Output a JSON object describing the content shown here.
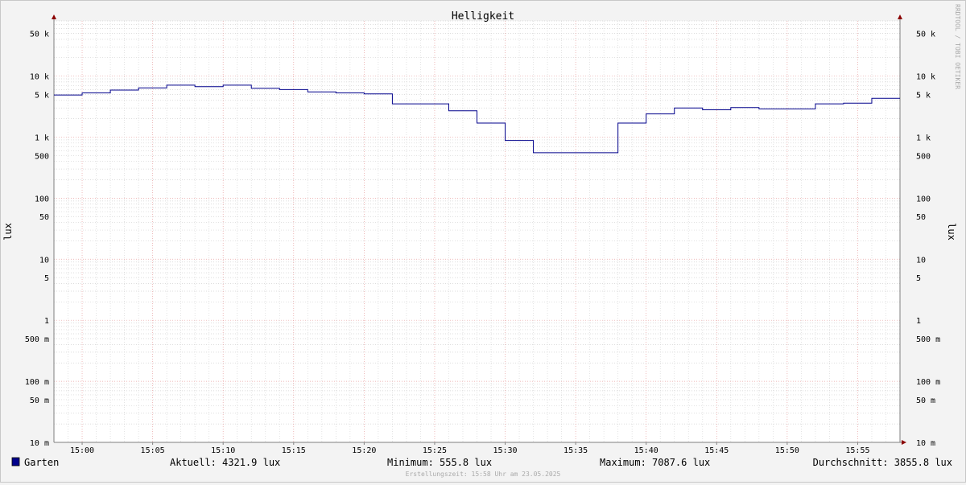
{
  "chart_data": {
    "type": "line",
    "title": "Helligkeit",
    "ylabel": "lux",
    "ylabel_right": "lux",
    "y_scale": "log",
    "ylim": [
      0.01,
      80000
    ],
    "y_ticks": [
      {
        "value": 50000,
        "label": "50 k"
      },
      {
        "value": 10000,
        "label": "10 k"
      },
      {
        "value": 5000,
        "label": "5 k"
      },
      {
        "value": 1000,
        "label": "1 k"
      },
      {
        "value": 500,
        "label": "500"
      },
      {
        "value": 100,
        "label": "100"
      },
      {
        "value": 50,
        "label": "50"
      },
      {
        "value": 10,
        "label": "10"
      },
      {
        "value": 5,
        "label": "5"
      },
      {
        "value": 1,
        "label": "1"
      },
      {
        "value": 0.5,
        "label": "500 m"
      },
      {
        "value": 0.1,
        "label": "100 m"
      },
      {
        "value": 0.05,
        "label": "50 m"
      },
      {
        "value": 0.01,
        "label": "10 m"
      }
    ],
    "x_range": [
      "14:58",
      "15:58"
    ],
    "x_ticks": [
      "15:00",
      "15:05",
      "15:10",
      "15:15",
      "15:20",
      "15:25",
      "15:30",
      "15:35",
      "15:40",
      "15:45",
      "15:50",
      "15:55"
    ],
    "series": [
      {
        "name": "Garten",
        "color": "#00008b",
        "x": [
          "14:58",
          "15:00",
          "15:02",
          "15:04",
          "15:06",
          "15:08",
          "15:10",
          "15:12",
          "15:14",
          "15:16",
          "15:18",
          "15:20",
          "15:22",
          "15:24",
          "15:26",
          "15:28",
          "15:30",
          "15:32",
          "15:34",
          "15:36",
          "15:38",
          "15:40",
          "15:42",
          "15:44",
          "15:46",
          "15:48",
          "15:50",
          "15:52",
          "15:54",
          "15:56"
        ],
        "values": [
          4900,
          5300,
          5900,
          6400,
          7080,
          6700,
          7087.6,
          6300,
          6000,
          5500,
          5300,
          5100,
          3500,
          3500,
          2700,
          1700,
          880,
          555.8,
          555.8,
          555.8,
          1700,
          2400,
          3000,
          2800,
          3050,
          2900,
          2900,
          3500,
          3600,
          4321.9
        ]
      }
    ],
    "grid": true,
    "watermark": "RRDTOOL / TOBI OETIKER",
    "legend": {
      "name": "Garten",
      "current": "Aktuell: 4321.9 lux",
      "minimum": "Minimum: 555.8 lux",
      "maximum": "Maximum: 7087.6 lux",
      "average": "Durchschnitt: 3855.8 lux"
    },
    "footer": "Erstellungszeit: 15:58 Uhr am 23.05.2025"
  }
}
